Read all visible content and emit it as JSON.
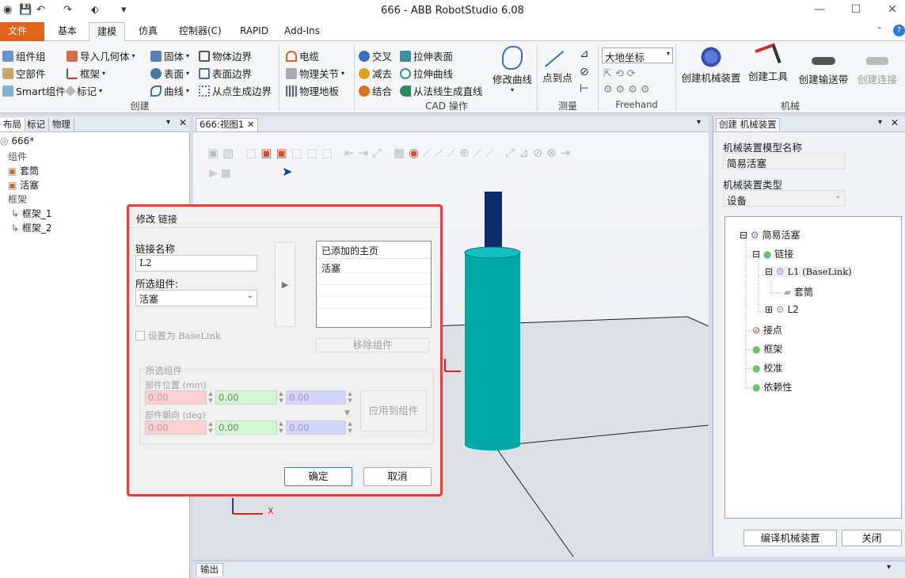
{
  "window": {
    "title": "666 - ABB RobotStudio 6.08",
    "minimize": "—",
    "maximize": "☐",
    "close": "✕"
  },
  "quickaccess": {
    "save": "💾",
    "undo": "↶",
    "redo": "↷",
    "customize": "▾"
  },
  "tabs": [
    {
      "label": "文件 (F)"
    },
    {
      "label": "基本"
    },
    {
      "label": "建模"
    },
    {
      "label": "仿真"
    },
    {
      "label": "控制器(C)"
    },
    {
      "label": "RAPID"
    },
    {
      "label": "Add-Ins"
    }
  ],
  "ribbon": {
    "create": {
      "label": "创建",
      "items": [
        "组件组",
        "空部件",
        "Smart组件",
        "导入几何体",
        "框架",
        "标记",
        "固体",
        "表面",
        "曲线",
        "物体边界",
        "表面边界",
        "从点生成边界"
      ]
    },
    "physics": {
      "items": [
        "电缆",
        "物理关节",
        "物理地板"
      ]
    },
    "cad": {
      "label": "CAD 操作",
      "items": [
        "交叉",
        "减去",
        "结合",
        "拉伸表面",
        "拉伸曲线",
        "从法线生成直线",
        "修改曲线"
      ]
    },
    "measure": {
      "label": "测量",
      "items": [
        "点到点"
      ]
    },
    "freehand": {
      "label": "Freehand",
      "ref": "大地坐标"
    },
    "mechanism": {
      "label": "机械",
      "items": [
        "创建机械装置",
        "创建工具",
        "创建输送带",
        "创建连接"
      ]
    }
  },
  "leftpanel": {
    "tabs": [
      "布局",
      "标记",
      "物理"
    ],
    "tree": {
      "root": "666*",
      "group1": "组件",
      "item1": "套筒",
      "item2": "活塞",
      "group2": "框架",
      "frame1": "框架_1",
      "frame2": "框架_2"
    }
  },
  "viewport": {
    "tab": "666:视图1",
    "axis_x": "X"
  },
  "rightpanel": {
    "tab": "创建 机械装置",
    "name_label": "机械装置模型名称",
    "name_value": "简易活塞",
    "type_label": "机械装置类型",
    "type_value": "设备",
    "tree": {
      "root": "简易活塞",
      "links": "链接",
      "l1": "L1 (BaseLink)",
      "l1child": "套筒",
      "l2": "L2",
      "joints": "接点",
      "frames": "框架",
      "calib": "校准",
      "deps": "依赖性"
    },
    "compile_btn": "编译机械装置",
    "close_btn": "关闭"
  },
  "output": {
    "tab": "输出"
  },
  "dialog": {
    "title": "修改 链接",
    "link_name_label": "链接名称",
    "link_name_value": "L2",
    "selected_part_label": "所选组件:",
    "selected_part_value": "活塞",
    "list_header": "已添加的主页",
    "list_items": [
      "活塞"
    ],
    "remove_btn": "移除组件",
    "baselink_label": "设置为 BaseLink",
    "group_label": "所选组件",
    "pos_label": "部件位置 (mm)",
    "orient_label": "部件朝向 (deg)",
    "pos": [
      "0.00",
      "0.00",
      "0.00"
    ],
    "orient": [
      "0.00",
      "0.00",
      "0.00"
    ],
    "apply_btn": "应用到组件",
    "ok_btn": "确定",
    "cancel_btn": "取消"
  },
  "colors": {
    "file_tab": "#e4631c",
    "dialog_border": "#e04040",
    "cylinder": "#00a9a8",
    "rod": "#0d2a6b"
  }
}
